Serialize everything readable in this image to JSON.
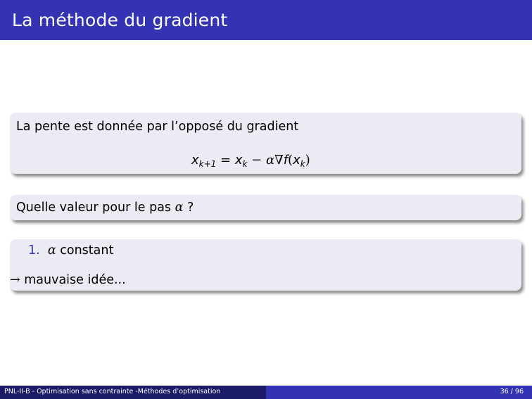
{
  "slide": {
    "title": "La méthode du gradient",
    "block1": {
      "text": "La pente est donnée par l’opposé du gradient",
      "formula": {
        "x": "x",
        "sub_k1": "k+1",
        "eq": " = ",
        "x2": "x",
        "sub_k": "k",
        "minus": " − ",
        "alpha": "α",
        "nabla": "∇",
        "f": "f",
        "open": "(",
        "x3": "x",
        "sub_k2": "k",
        "close": ")"
      }
    },
    "block2": {
      "text_before": "Quelle valeur pour le pas ",
      "alpha": "α",
      "text_after": " ?"
    },
    "block3": {
      "item_number": "1.",
      "alpha": "α",
      "item_text": " constant",
      "arrow": "→",
      "conclusion": " mauvaise idée..."
    }
  },
  "footer": {
    "left": "PNL-II-B - Optimisation sans contrainte -Méthodes d’optimisation",
    "page": "36 / 96"
  }
}
